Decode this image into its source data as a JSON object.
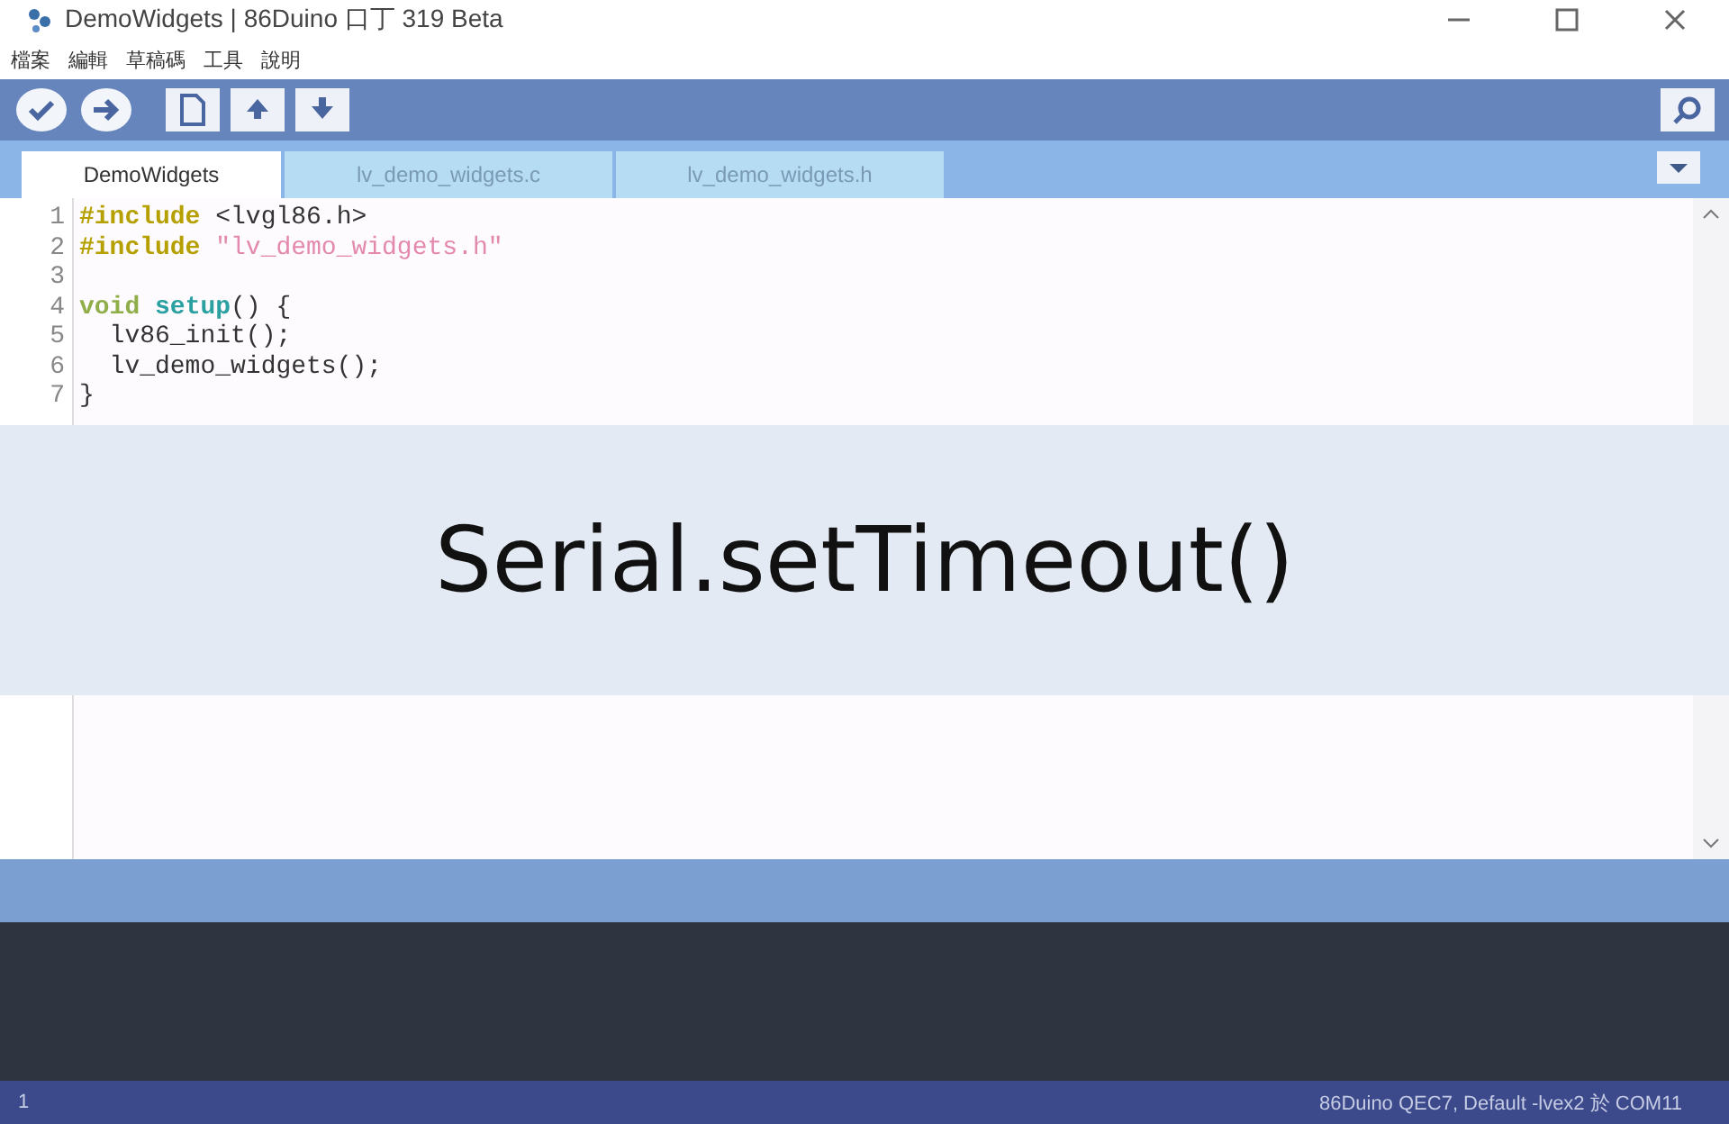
{
  "window": {
    "title": "DemoWidgets | 86Duino 口丁 319 Beta"
  },
  "menu": [
    "檔案",
    "編輯",
    "草稿碼",
    "工具",
    "說明"
  ],
  "tabs": [
    {
      "label": "DemoWidgets",
      "selected": true
    },
    {
      "label": "lv_demo_widgets.c",
      "selected": false
    },
    {
      "label": "lv_demo_widgets.h",
      "selected": false
    }
  ],
  "editor": {
    "lines": [
      {
        "number": "1",
        "tokens": [
          {
            "kind": "directive",
            "text": "#include"
          },
          {
            "kind": "plain",
            "text": " <lvgl86.h>"
          }
        ]
      },
      {
        "number": "2",
        "tokens": [
          {
            "kind": "directive",
            "text": "#include"
          },
          {
            "kind": "string",
            "text": " \"lv_demo_widgets.h\""
          }
        ]
      },
      {
        "number": "3"
      },
      {
        "number": "4",
        "tokens": [
          {
            "kind": "keyword",
            "text": "void "
          },
          {
            "kind": "function",
            "text": "setup"
          },
          {
            "kind": "plain",
            "text": "() {"
          }
        ]
      },
      {
        "number": "5",
        "tokens": [
          {
            "kind": "plain",
            "text": "  lv86_init();"
          }
        ]
      },
      {
        "number": "6",
        "tokens": [
          {
            "kind": "plain",
            "text": "  lv_demo_widgets();"
          }
        ]
      },
      {
        "number": "7",
        "tokens": [
          {
            "kind": "plain",
            "text": "}"
          }
        ]
      }
    ]
  },
  "banner": {
    "text": "Serial.setTimeout()"
  },
  "status_bar": {
    "line": "1",
    "board": "86Duino QEC7, Default -lvex2 於 COM11"
  }
}
